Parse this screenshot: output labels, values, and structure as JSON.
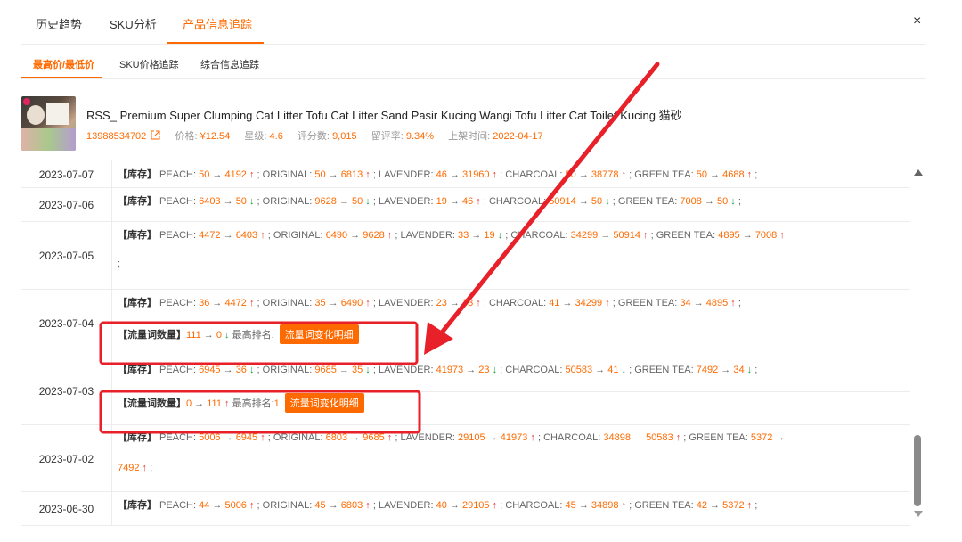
{
  "tabs": [
    {
      "label": "历史趋势"
    },
    {
      "label": "SKU分析"
    },
    {
      "label": "产品信息追踪"
    }
  ],
  "close_label": "×",
  "subtabs": [
    {
      "label": "最高价/最低价"
    },
    {
      "label": "SKU价格追踪"
    },
    {
      "label": "综合信息追踪"
    }
  ],
  "product": {
    "title": "RSS_ Premium Super Clumping Cat Litter Tofu Cat Litter Sand Pasir Kucing Wangi Tofu Litter Cat Toilet Kucing 猫砂",
    "id": "13988534702",
    "price_label": "价格:",
    "price": "¥12.54",
    "rating_label": "星级:",
    "rating": "4.6",
    "reviews_label": "评分数:",
    "reviews": "9,015",
    "review_rate_label": "留评率:",
    "review_rate": "9.34%",
    "listed_label": "上架时间:",
    "listed": "2022-04-17"
  },
  "stock_tag": "【库存】",
  "traffic_tag": "【流量词数量】",
  "max_rank_label": "最高排名:",
  "detail_button": "流量词变化明细",
  "rows": [
    {
      "date": "2023-07-07",
      "stock": [
        {
          "name": "PEACH",
          "from": "50",
          "to": "4192",
          "dir": "up"
        },
        {
          "name": "ORIGINAL",
          "from": "50",
          "to": "6813",
          "dir": "up"
        },
        {
          "name": "LAVENDER",
          "from": "46",
          "to": "31960",
          "dir": "up"
        },
        {
          "name": "CHARCOAL",
          "from": "50",
          "to": "38778",
          "dir": "up"
        },
        {
          "name": "GREEN TEA",
          "from": "50",
          "to": "4688",
          "dir": "up"
        }
      ]
    },
    {
      "date": "2023-07-06",
      "stock": [
        {
          "name": "PEACH",
          "from": "6403",
          "to": "50",
          "dir": "down"
        },
        {
          "name": "ORIGINAL",
          "from": "9628",
          "to": "50",
          "dir": "down"
        },
        {
          "name": "LAVENDER",
          "from": "19",
          "to": "46",
          "dir": "up"
        },
        {
          "name": "CHARCOAL",
          "from": "50914",
          "to": "50",
          "dir": "down"
        },
        {
          "name": "GREEN TEA",
          "from": "7008",
          "to": "50",
          "dir": "down"
        }
      ]
    },
    {
      "date": "2023-07-05",
      "stock": [
        {
          "name": "PEACH",
          "from": "4472",
          "to": "6403",
          "dir": "up"
        },
        {
          "name": "ORIGINAL",
          "from": "6490",
          "to": "9628",
          "dir": "up"
        },
        {
          "name": "LAVENDER",
          "from": "33",
          "to": "19",
          "dir": "down"
        },
        {
          "name": "CHARCOAL",
          "from": "34299",
          "to": "50914",
          "dir": "up"
        },
        {
          "name": "GREEN TEA",
          "from": "4895",
          "to": "7008",
          "dir": "up"
        }
      ]
    },
    {
      "date": "2023-07-04",
      "stock": [
        {
          "name": "PEACH",
          "from": "36",
          "to": "4472",
          "dir": "up"
        },
        {
          "name": "ORIGINAL",
          "from": "35",
          "to": "6490",
          "dir": "up"
        },
        {
          "name": "LAVENDER",
          "from": "23",
          "to": "33",
          "dir": "up"
        },
        {
          "name": "CHARCOAL",
          "from": "41",
          "to": "34299",
          "dir": "up"
        },
        {
          "name": "GREEN TEA",
          "from": "34",
          "to": "4895",
          "dir": "up"
        }
      ],
      "traffic": {
        "from": "111",
        "to": "0",
        "dir": "down",
        "rank": ""
      }
    },
    {
      "date": "2023-07-03",
      "stock": [
        {
          "name": "PEACH",
          "from": "6945",
          "to": "36",
          "dir": "down"
        },
        {
          "name": "ORIGINAL",
          "from": "9685",
          "to": "35",
          "dir": "down"
        },
        {
          "name": "LAVENDER",
          "from": "41973",
          "to": "23",
          "dir": "down"
        },
        {
          "name": "CHARCOAL",
          "from": "50583",
          "to": "41",
          "dir": "down"
        },
        {
          "name": "GREEN TEA",
          "from": "7492",
          "to": "34",
          "dir": "down"
        }
      ],
      "traffic": {
        "from": "0",
        "to": "111",
        "dir": "up",
        "rank": "1"
      }
    },
    {
      "date": "2023-07-02",
      "stock": [
        {
          "name": "PEACH",
          "from": "5006",
          "to": "6945",
          "dir": "up"
        },
        {
          "name": "ORIGINAL",
          "from": "6803",
          "to": "9685",
          "dir": "up"
        },
        {
          "name": "LAVENDER",
          "from": "29105",
          "to": "41973",
          "dir": "up"
        },
        {
          "name": "CHARCOAL",
          "from": "34898",
          "to": "50583",
          "dir": "up"
        },
        {
          "name": "GREEN TEA",
          "from": "5372",
          "to": "7492",
          "dir": "up"
        }
      ]
    },
    {
      "date": "2023-06-30",
      "stock": [
        {
          "name": "PEACH",
          "from": "44",
          "to": "5006",
          "dir": "up"
        },
        {
          "name": "ORIGINAL",
          "from": "45",
          "to": "6803",
          "dir": "up"
        },
        {
          "name": "LAVENDER",
          "from": "40",
          "to": "29105",
          "dir": "up"
        },
        {
          "name": "CHARCOAL",
          "from": "45",
          "to": "34898",
          "dir": "up"
        },
        {
          "name": "GREEN TEA",
          "from": "42",
          "to": "5372",
          "dir": "up"
        }
      ]
    }
  ],
  "colors": {
    "accent": "#ff6a00",
    "up": "#e4393c",
    "down": "#1a9b4a",
    "annotation": "#e8202a"
  }
}
